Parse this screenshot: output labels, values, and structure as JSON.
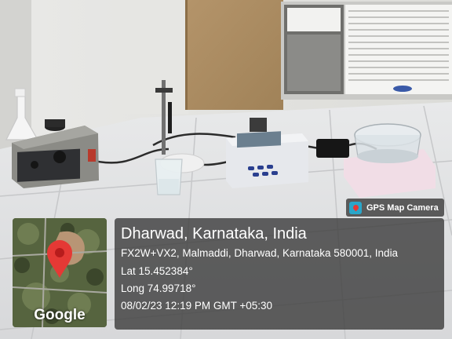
{
  "overlay": {
    "badge_label": "GPS Map Camera",
    "badge_icon": "gps-map-camera-icon",
    "city_line": "Dharwad, Karnataka, India",
    "address_line": "FX2W+VX2, Malmaddi, Dharwad, Karnataka 580001, India",
    "latitude_line": "Lat 15.452384°",
    "longitude_line": "Long 74.99718°",
    "datetime_line": "08/02/23 12:19 PM GMT +05:30",
    "map_logo": "Google",
    "map_pin_icon": "map-pin-icon",
    "pin_color": "#e53935"
  }
}
